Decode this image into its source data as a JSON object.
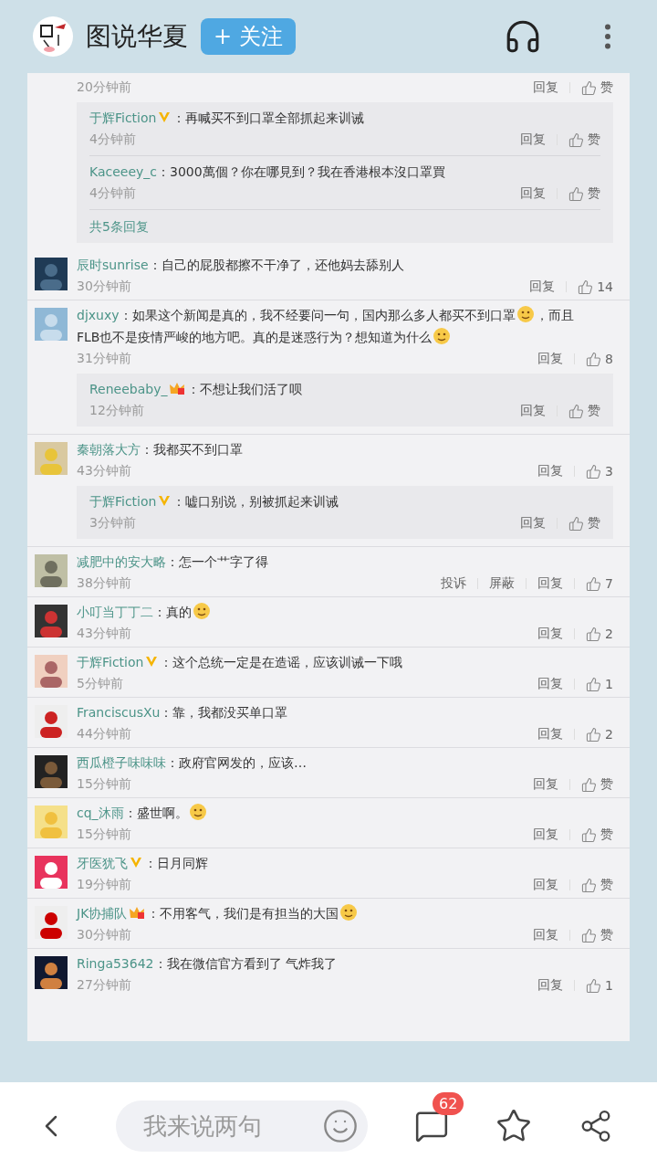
{
  "header": {
    "title": "图说华夏",
    "follow_button": "+ 关注"
  },
  "top_comment": {
    "time": "20分钟前",
    "actions": [
      "回复"
    ],
    "like": "赞",
    "replies": [
      {
        "user": "于辉Fiction",
        "verified": true,
        "crown": false,
        "parts": [
          {
            "kind": "text",
            "text": "：再喊买不到口罩全部抓起来训诫"
          }
        ],
        "time": "4分钟前",
        "actions": [
          "回复"
        ],
        "like": "赞"
      },
      {
        "user": "Kaceeey_c",
        "verified": false,
        "crown": false,
        "parts": [
          {
            "kind": "text",
            "text": "：3000萬個？你在哪見到？我在香港根本沒口罩買"
          }
        ],
        "time": "4分钟前",
        "actions": [
          "回复"
        ],
        "like": "赞"
      }
    ],
    "more_replies": "共5条回复"
  },
  "comments": [
    {
      "user": "辰时sunrise",
      "verified": false,
      "crown": false,
      "parts": [
        {
          "kind": "text",
          "text": "：自己的屁股都擦不干净了，还他妈去舔别人"
        }
      ],
      "time": "30分钟前",
      "actions": [
        "回复"
      ],
      "like": "14"
    },
    {
      "user": "djxuxy",
      "verified": false,
      "crown": false,
      "parts": [
        {
          "kind": "text",
          "text": "：如果这个新闻是真的，我不经要问一句，国内那么多人都买不到口罩"
        },
        {
          "kind": "emoji"
        },
        {
          "kind": "text",
          "text": "，而且"
        },
        {
          "kind": "text",
          "text": "FLB也不是疫情严峻的地方吧。真的是迷惑行为？想知道为什么"
        },
        {
          "kind": "emoji"
        }
      ],
      "time": "31分钟前",
      "actions": [
        "回复"
      ],
      "like": "8",
      "replies": [
        {
          "user": "Reneebaby_",
          "verified": false,
          "crown": true,
          "parts": [
            {
              "kind": "text",
              "text": "：不想让我们活了呗"
            }
          ],
          "time": "12分钟前",
          "actions": [
            "回复"
          ],
          "like": "赞"
        }
      ]
    },
    {
      "user": "秦朝落大方",
      "verified": false,
      "crown": false,
      "parts": [
        {
          "kind": "text",
          "text": "：我都买不到口罩"
        }
      ],
      "time": "43分钟前",
      "actions": [
        "回复"
      ],
      "like": "3",
      "replies": [
        {
          "user": "于辉Fiction",
          "verified": true,
          "crown": false,
          "parts": [
            {
              "kind": "text",
              "text": "：嘘口别说，别被抓起来训诫"
            }
          ],
          "time": "3分钟前",
          "actions": [
            "回复"
          ],
          "like": "赞"
        }
      ]
    },
    {
      "user": "减肥中的安大略",
      "verified": false,
      "crown": false,
      "parts": [
        {
          "kind": "text",
          "text": "：怎一个艹字了得"
        }
      ],
      "time": "38分钟前",
      "actions": [
        "投诉",
        "屏蔽",
        "回复"
      ],
      "like": "7"
    },
    {
      "user": "小叮当丁丁二",
      "verified": false,
      "crown": false,
      "parts": [
        {
          "kind": "text",
          "text": "：真的"
        },
        {
          "kind": "emoji"
        }
      ],
      "time": "43分钟前",
      "actions": [
        "回复"
      ],
      "like": "2"
    },
    {
      "user": "于辉Fiction",
      "verified": true,
      "crown": false,
      "parts": [
        {
          "kind": "text",
          "text": "：这个总统一定是在造谣，应该训诫一下哦"
        }
      ],
      "time": "5分钟前",
      "actions": [
        "回复"
      ],
      "like": "1"
    },
    {
      "user": "FranciscusXu",
      "verified": false,
      "crown": false,
      "parts": [
        {
          "kind": "text",
          "text": "：靠，我都没买单口罩"
        }
      ],
      "time": "44分钟前",
      "actions": [
        "回复"
      ],
      "like": "2"
    },
    {
      "user": "西瓜橙子味味味",
      "verified": false,
      "crown": false,
      "parts": [
        {
          "kind": "text",
          "text": "：政府官网发的，应该…"
        }
      ],
      "time": "15分钟前",
      "actions": [
        "回复"
      ],
      "like": "赞"
    },
    {
      "user": "cq_沐雨",
      "verified": false,
      "crown": false,
      "parts": [
        {
          "kind": "text",
          "text": "：盛世啊。"
        },
        {
          "kind": "emoji"
        }
      ],
      "time": "15分钟前",
      "actions": [
        "回复"
      ],
      "like": "赞"
    },
    {
      "user": "牙医犹飞",
      "verified": true,
      "crown": false,
      "parts": [
        {
          "kind": "text",
          "text": "：日月同辉"
        }
      ],
      "time": "19分钟前",
      "actions": [
        "回复"
      ],
      "like": "赞"
    },
    {
      "user": "JK协捕队",
      "verified": false,
      "crown": true,
      "parts": [
        {
          "kind": "text",
          "text": "：不用客气，我们是有担当的大国"
        },
        {
          "kind": "emoji"
        }
      ],
      "time": "30分钟前",
      "actions": [
        "回复"
      ],
      "like": "赞"
    },
    {
      "user": "Ringa53642",
      "verified": false,
      "crown": false,
      "parts": [
        {
          "kind": "text",
          "text": "：我在微信官方看到了 气炸我了"
        }
      ],
      "time": "27分钟前",
      "actions": [
        "回复"
      ],
      "like": "1"
    }
  ],
  "bottom_bar": {
    "placeholder": "我来说两句",
    "comment_count": "62"
  }
}
